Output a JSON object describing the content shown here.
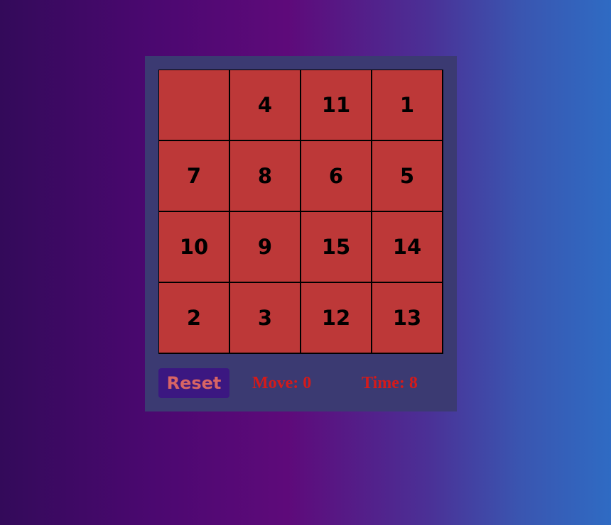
{
  "game": {
    "tiles": [
      "",
      "4",
      "11",
      "1",
      "7",
      "8",
      "6",
      "5",
      "10",
      "9",
      "15",
      "14",
      "2",
      "3",
      "12",
      "13"
    ],
    "empty_index": 0
  },
  "controls": {
    "reset_label": "Reset",
    "moves_text": "Move: 0",
    "time_text": "Time: 8"
  },
  "colors": {
    "tile": "#bd3838",
    "panel": "#3b3a72",
    "button": "#3b1781",
    "button_text": "#d86464",
    "stat_text": "#d41a1a"
  }
}
